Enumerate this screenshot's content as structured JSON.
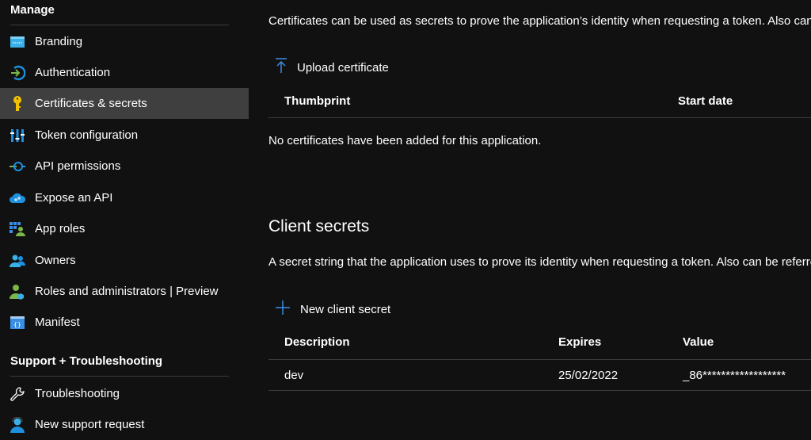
{
  "sidebar": {
    "manage_heading": "Manage",
    "items": [
      {
        "label": "Branding",
        "icon": "branding-icon"
      },
      {
        "label": "Authentication",
        "icon": "authentication-icon"
      },
      {
        "label": "Certificates & secrets",
        "icon": "key-icon",
        "active": true
      },
      {
        "label": "Token configuration",
        "icon": "token-configuration-icon"
      },
      {
        "label": "API permissions",
        "icon": "api-permissions-icon"
      },
      {
        "label": "Expose an API",
        "icon": "cloud-icon"
      },
      {
        "label": "App roles",
        "icon": "app-roles-icon"
      },
      {
        "label": "Owners",
        "icon": "owners-icon"
      },
      {
        "label": "Roles and administrators | Preview",
        "icon": "roles-admin-icon"
      },
      {
        "label": "Manifest",
        "icon": "manifest-icon"
      }
    ],
    "support_heading": "Support + Troubleshooting",
    "support_items": [
      {
        "label": "Troubleshooting",
        "icon": "wrench-icon"
      },
      {
        "label": "New support request",
        "icon": "support-person-icon"
      }
    ]
  },
  "certificates": {
    "description": "Certificates can be used as secrets to prove the application’s identity when requesting a token. Also can be referred to as public keys.",
    "upload_label": "Upload certificate",
    "columns": [
      "Thumbprint",
      "Start date"
    ],
    "empty_message": "No certificates have been added for this application."
  },
  "client_secrets": {
    "title": "Client secrets",
    "description": "A secret string that the application uses to prove its identity when requesting a token. Also can be referred to as application password.",
    "new_label": "New client secret",
    "columns": [
      "Description",
      "Expires",
      "Value"
    ],
    "rows": [
      {
        "description": "dev",
        "expires": "25/02/2022",
        "value": "_86******************"
      }
    ]
  },
  "colors": {
    "background": "#111111",
    "active_item": "#3f3f3f",
    "accent_blue": "#3a8ee6",
    "key_yellow": "#f2c200",
    "green": "#7ab648"
  }
}
